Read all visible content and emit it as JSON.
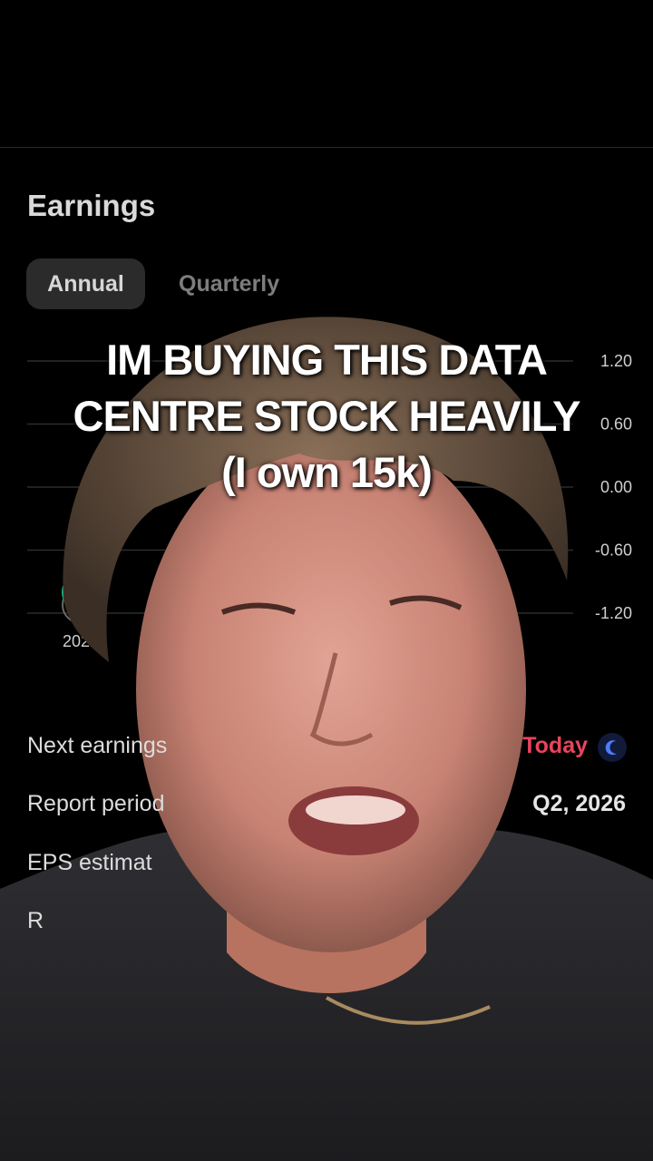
{
  "earnings": {
    "title": "Earnings",
    "tabs": [
      {
        "label": "Annual",
        "selected": true
      },
      {
        "label": "Quarterly",
        "selected": false
      }
    ]
  },
  "chart_data": {
    "type": "scatter",
    "categories": [
      "2022"
    ],
    "y_ticks": [
      "1.20",
      "0.60",
      "0.00",
      "-0.60",
      "-1.20"
    ],
    "ylim": [
      -1.2,
      1.2
    ],
    "points": [
      {
        "x": "2022",
        "y": -1.0
      }
    ],
    "accent": "#1fbf84"
  },
  "caption": {
    "line1": "IM BUYING THIS DATA",
    "line2": "CENTRE STOCK HEAVILY",
    "line3": "(I own 15k)"
  },
  "details": {
    "next_earnings_label": "Next earnings",
    "next_earnings_value": "Today",
    "report_period_label": "Report period",
    "report_period_value": "Q2, 2026",
    "eps_estimate_label": "EPS estimat",
    "partial_label": "R",
    "moon_icon": "moon-icon",
    "today_color": "#e8445d"
  }
}
